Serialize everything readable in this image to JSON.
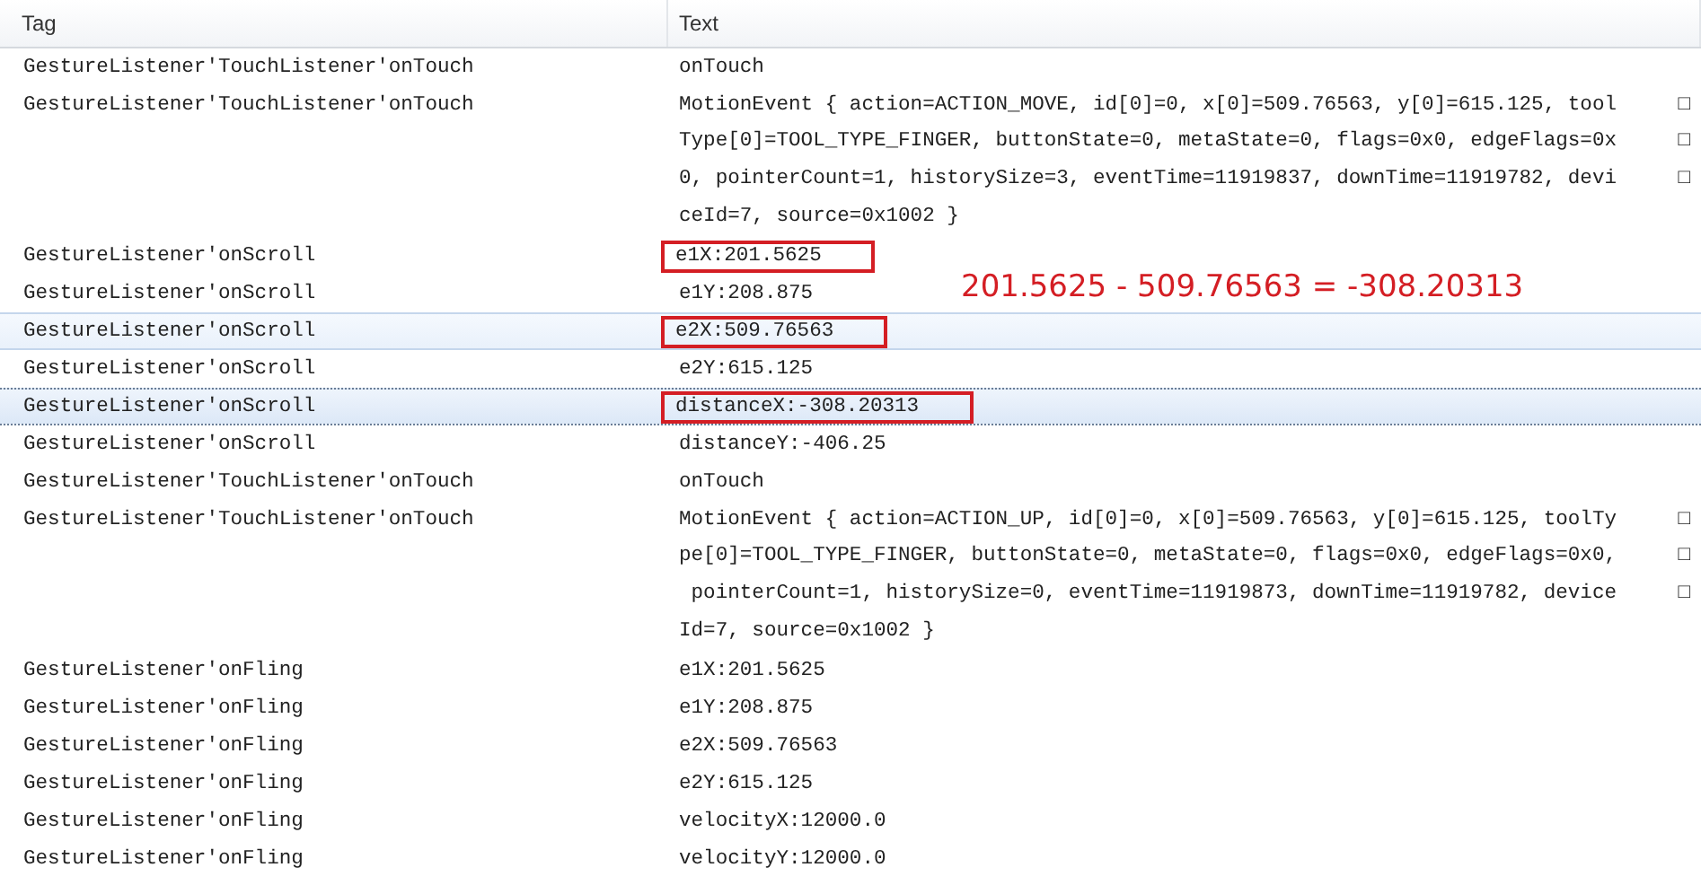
{
  "columns": [
    "Tag",
    "Text"
  ],
  "annotation": "201.5625 - 509.76563 = -308.20313",
  "rows": [
    {
      "tag": "GestureListener'TouchListener'onTouch",
      "lines": [
        {
          "text": "onTouch"
        }
      ],
      "selected": false,
      "hovered": false,
      "boxed": false
    },
    {
      "tag": "GestureListener'TouchListener'onTouch",
      "lines": [
        {
          "text": "MotionEvent { action=ACTION_MOVE, id[0]=0, x[0]=509.76563, y[0]=615.125, tool",
          "mark": "□"
        },
        {
          "text": "Type[0]=TOOL_TYPE_FINGER, buttonState=0, metaState=0, flags=0x0, edgeFlags=0x",
          "mark": "□"
        },
        {
          "text": "0, pointerCount=1, historySize=3, eventTime=11919837, downTime=11919782, devi",
          "mark": "□"
        },
        {
          "text": "ceId=7, source=0x1002 }"
        }
      ],
      "selected": false,
      "hovered": false,
      "boxed": false
    },
    {
      "tag": "GestureListener'onScroll",
      "lines": [
        {
          "text": "e1X:201.5625"
        }
      ],
      "selected": false,
      "hovered": false,
      "boxed": true
    },
    {
      "tag": "GestureListener'onScroll",
      "lines": [
        {
          "text": "e1Y:208.875"
        }
      ],
      "selected": false,
      "hovered": false,
      "boxed": false,
      "annotated": true
    },
    {
      "tag": "GestureListener'onScroll",
      "lines": [
        {
          "text": "e2X:509.76563"
        }
      ],
      "selected": false,
      "hovered": true,
      "boxed": true
    },
    {
      "tag": "GestureListener'onScroll",
      "lines": [
        {
          "text": "e2Y:615.125"
        }
      ],
      "selected": false,
      "hovered": false,
      "boxed": false
    },
    {
      "tag": "GestureListener'onScroll",
      "lines": [
        {
          "text": "distanceX:-308.20313"
        }
      ],
      "selected": true,
      "hovered": false,
      "boxed": true
    },
    {
      "tag": "GestureListener'onScroll",
      "lines": [
        {
          "text": "distanceY:-406.25"
        }
      ],
      "selected": false,
      "hovered": false,
      "boxed": false
    },
    {
      "tag": "GestureListener'TouchListener'onTouch",
      "lines": [
        {
          "text": "onTouch"
        }
      ],
      "selected": false,
      "hovered": false,
      "boxed": false
    },
    {
      "tag": "GestureListener'TouchListener'onTouch",
      "lines": [
        {
          "text": "MotionEvent { action=ACTION_UP, id[0]=0, x[0]=509.76563, y[0]=615.125, toolTy",
          "mark": "□"
        },
        {
          "text": "pe[0]=TOOL_TYPE_FINGER, buttonState=0, metaState=0, flags=0x0, edgeFlags=0x0,",
          "mark": "□"
        },
        {
          "text": " pointerCount=1, historySize=0, eventTime=11919873, downTime=11919782, device",
          "mark": "□"
        },
        {
          "text": "Id=7, source=0x1002 }"
        }
      ],
      "selected": false,
      "hovered": false,
      "boxed": false
    },
    {
      "tag": "GestureListener'onFling",
      "lines": [
        {
          "text": "e1X:201.5625"
        }
      ],
      "selected": false,
      "hovered": false,
      "boxed": false
    },
    {
      "tag": "GestureListener'onFling",
      "lines": [
        {
          "text": "e1Y:208.875"
        }
      ],
      "selected": false,
      "hovered": false,
      "boxed": false
    },
    {
      "tag": "GestureListener'onFling",
      "lines": [
        {
          "text": "e2X:509.76563"
        }
      ],
      "selected": false,
      "hovered": false,
      "boxed": false
    },
    {
      "tag": "GestureListener'onFling",
      "lines": [
        {
          "text": "e2Y:615.125"
        }
      ],
      "selected": false,
      "hovered": false,
      "boxed": false
    },
    {
      "tag": "GestureListener'onFling",
      "lines": [
        {
          "text": "velocityX:12000.0"
        }
      ],
      "selected": false,
      "hovered": false,
      "boxed": false
    },
    {
      "tag": "GestureListener'onFling",
      "lines": [
        {
          "text": "velocityY:12000.0"
        }
      ],
      "selected": false,
      "hovered": false,
      "boxed": false
    }
  ]
}
